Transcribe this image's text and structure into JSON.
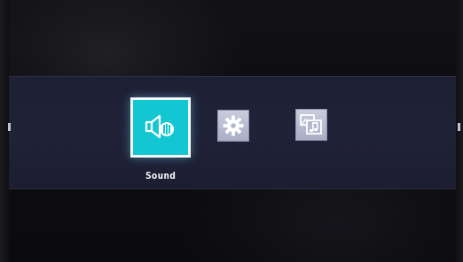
{
  "menu": {
    "items": [
      {
        "id": "sound",
        "label": "Sound",
        "icon": "speaker-icon",
        "selected": true
      },
      {
        "id": "settings",
        "label": "",
        "icon": "gear-icon",
        "selected": false
      },
      {
        "id": "media",
        "label": "",
        "icon": "media-browser-icon",
        "selected": false
      }
    ],
    "selected_label": "Sound"
  },
  "colors": {
    "band": "#202238",
    "selected_tile": "#12c7d2",
    "selected_border": "#f2fbff",
    "normal_tile": "#b7bbd1",
    "text": "#ffffff"
  }
}
